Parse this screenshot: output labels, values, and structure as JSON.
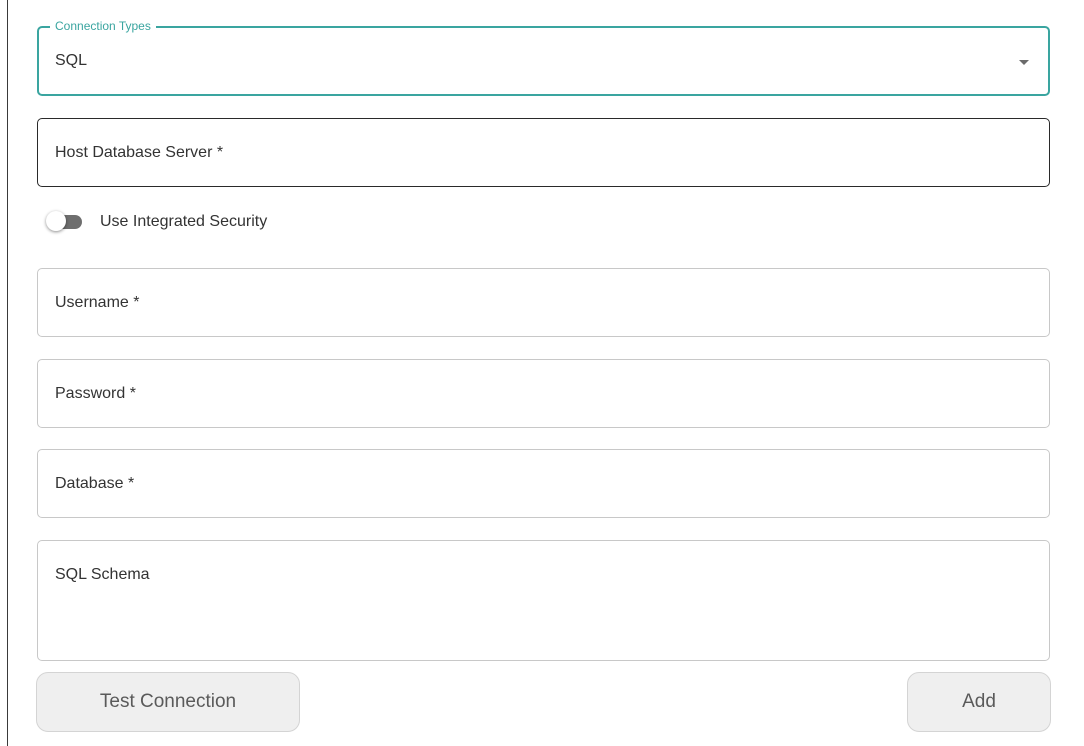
{
  "connection_type": {
    "label": "Connection Types",
    "selected": "SQL"
  },
  "fields": {
    "host": "Host Database Server *",
    "username": "Username *",
    "password": "Password *",
    "database": "Database *",
    "schema": "SQL Schema"
  },
  "integrated_security": {
    "label": "Use Integrated Security",
    "enabled": false
  },
  "buttons": {
    "test_connection": "Test Connection",
    "add": "Add"
  },
  "colors": {
    "accent": "#3aa5a0",
    "button_bg": "#efefef"
  }
}
